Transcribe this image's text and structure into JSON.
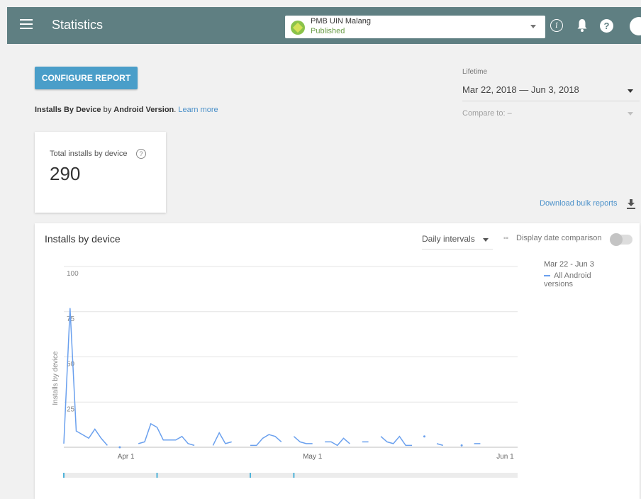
{
  "header": {
    "title": "Statistics",
    "app_name": "PMB UIN Malang",
    "app_status": "Published",
    "info_glyph": "i",
    "help_glyph": "?"
  },
  "report": {
    "configure_label": "CONFIGURE REPORT",
    "subtitle_part1": "Installs By Device",
    "subtitle_part2": " by ",
    "subtitle_part3": "Android Version",
    "subtitle_part4": ". ",
    "learn_more": "Learn more"
  },
  "range": {
    "label": "Lifetime",
    "value": "Mar 22, 2018 — Jun 3, 2018",
    "compare_label": "Compare to:  –"
  },
  "total": {
    "label": "Total installs by device",
    "help_glyph": "?",
    "value": "290"
  },
  "download_label": "Download bulk reports",
  "chart": {
    "title": "Installs by device",
    "interval_label": "Daily intervals",
    "compare_label": "Display date comparison",
    "legend_range": "Mar 22 - Jun 3",
    "legend_series": "All Android versions"
  },
  "colors": {
    "appbar": "#5f7f82",
    "accent": "#4a9ec9",
    "series": "#6aa0ee",
    "published": "#6a9c47"
  },
  "chart_data": {
    "type": "line",
    "ylabel": "Installs by device",
    "ylim": [
      0,
      100
    ],
    "yticks": [
      25,
      50,
      75,
      100
    ],
    "x_tick_labels": [
      "Apr 1",
      "May 1",
      "Jun 1"
    ],
    "x_tick_days": [
      10,
      40,
      71
    ],
    "x_range_days": [
      0,
      73
    ],
    "series": [
      {
        "name": "All Android versions",
        "day": [
          0,
          1,
          2,
          3,
          4,
          5,
          6,
          7,
          8,
          9,
          10,
          11,
          12,
          13,
          14,
          15,
          16,
          17,
          18,
          19,
          20,
          21,
          22,
          23,
          24,
          25,
          26,
          27,
          28,
          29,
          30,
          31,
          32,
          33,
          34,
          35,
          36,
          37,
          38,
          39,
          40,
          41,
          42,
          43,
          44,
          45,
          46,
          47,
          48,
          49,
          50,
          51,
          52,
          53,
          54,
          55,
          56,
          57,
          58,
          59,
          60,
          61,
          62,
          63,
          64,
          65,
          66,
          67,
          68,
          69,
          70,
          71,
          72,
          73
        ],
        "values": [
          2,
          77,
          9,
          7,
          5,
          10,
          5,
          1,
          null,
          0,
          null,
          null,
          2,
          3,
          13,
          11,
          4,
          4,
          4,
          6,
          2,
          1,
          null,
          null,
          1,
          8,
          2,
          3,
          null,
          null,
          1,
          1,
          5,
          7,
          6,
          3,
          null,
          6,
          3,
          2,
          2,
          null,
          3,
          3,
          1,
          5,
          2,
          null,
          3,
          3,
          null,
          6,
          3,
          2,
          6,
          1,
          1,
          null,
          6,
          null,
          2,
          1,
          null,
          null,
          1,
          null,
          2,
          2,
          null,
          null,
          null,
          null,
          null,
          null
        ]
      }
    ]
  }
}
